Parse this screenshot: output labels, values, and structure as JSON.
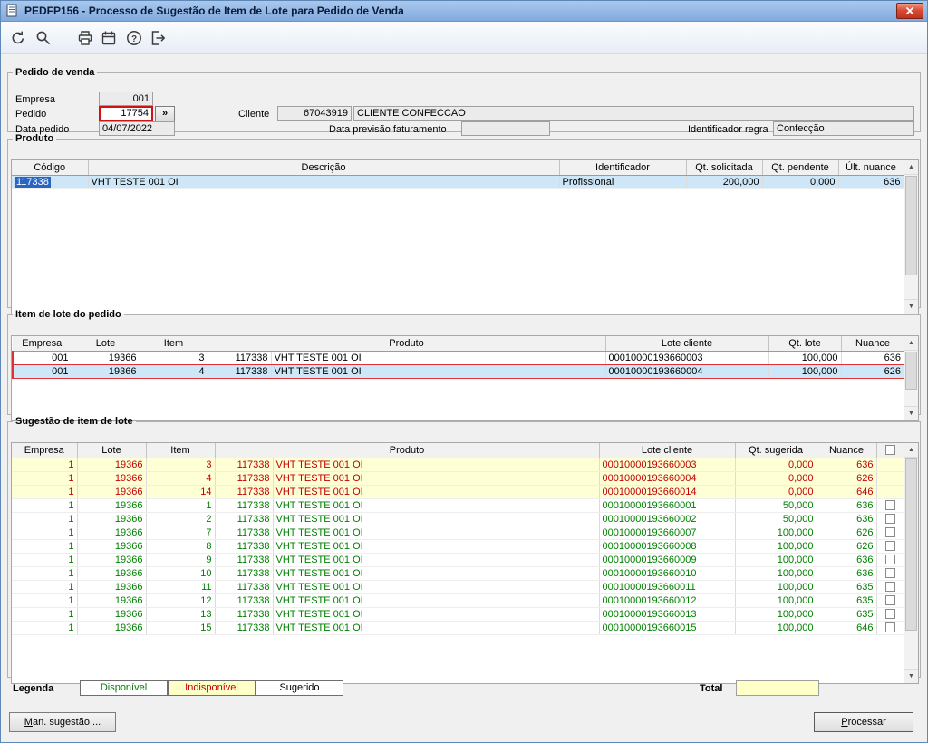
{
  "window": {
    "title": "PEDFP156 - Processo de Sugestão de Item de Lote para Pedido de Venda"
  },
  "toolbar": {
    "buttons": [
      "undo",
      "search",
      "print",
      "calendar",
      "help",
      "exit"
    ]
  },
  "icons": {
    "scroll_up": "▲",
    "scroll_down": "▼"
  },
  "form": {
    "group_title": "Pedido de venda",
    "empresa": {
      "label": "Empresa",
      "value": "001"
    },
    "pedido": {
      "label": "Pedido",
      "value": "17754",
      "lookup": "»"
    },
    "data_pedido": {
      "label": "Data pedido",
      "value": "04/07/2022"
    },
    "cliente": {
      "label": "Cliente",
      "code": "67043919",
      "name": "CLIENTE CONFECCAO"
    },
    "data_previsao": {
      "label": "Data previsão faturamento",
      "value": ""
    },
    "identificador_regra": {
      "label": "Identificador regra",
      "value": "Confecção"
    }
  },
  "produto": {
    "group_title": "Produto",
    "columns": [
      "Código",
      "Descrição",
      "Identificador",
      "Qt. solicitada",
      "Qt. pendente",
      "Últ. nuance"
    ],
    "rows": [
      {
        "status": "selected-produto",
        "codigo": "117338",
        "descricao": "VHT TESTE 001 OI",
        "identificador": "Profissional",
        "qt_solicitada": "200,000",
        "qt_pendente": "0,000",
        "ult_nuance": "636"
      }
    ]
  },
  "item_lote": {
    "group_title": "Item de lote do pedido",
    "columns": [
      "Empresa",
      "Lote",
      "Item",
      "Produto",
      "Lote cliente",
      "Qt. lote",
      "Nuance"
    ],
    "rows": [
      {
        "status": "outline",
        "empresa": "001",
        "lote": "19366",
        "item": "3",
        "produto_cod": "117338",
        "produto_desc": "VHT TESTE 001 OI",
        "lote_cliente": "00010000193660003",
        "qt_lote": "100,000",
        "nuance": "636"
      },
      {
        "status": "outline selected",
        "empresa": "001",
        "lote": "19366",
        "item": "4",
        "produto_cod": "117338",
        "produto_desc": "VHT TESTE 001 OI",
        "lote_cliente": "00010000193660004",
        "qt_lote": "100,000",
        "nuance": "626"
      }
    ]
  },
  "sugestao": {
    "group_title": "Sugestão de item de lote",
    "columns": [
      "Empresa",
      "Lote",
      "Item",
      "Produto",
      "Lote cliente",
      "Qt. sugerida",
      "Nuance"
    ],
    "rows": [
      {
        "status": "indisponivel",
        "checkbox": false,
        "empresa": "1",
        "lote": "19366",
        "item": "3",
        "produto_cod": "117338",
        "produto_desc": "VHT TESTE 001 OI",
        "lote_cliente": "00010000193660003",
        "qt_sugerida": "0,000",
        "nuance": "636"
      },
      {
        "status": "indisponivel",
        "checkbox": false,
        "empresa": "1",
        "lote": "19366",
        "item": "4",
        "produto_cod": "117338",
        "produto_desc": "VHT TESTE 001 OI",
        "lote_cliente": "00010000193660004",
        "qt_sugerida": "0,000",
        "nuance": "626"
      },
      {
        "status": "indisponivel",
        "checkbox": false,
        "empresa": "1",
        "lote": "19366",
        "item": "14",
        "produto_cod": "117338",
        "produto_desc": "VHT TESTE 001 OI",
        "lote_cliente": "00010000193660014",
        "qt_sugerida": "0,000",
        "nuance": "646"
      },
      {
        "status": "disponivel",
        "checkbox": true,
        "empresa": "1",
        "lote": "19366",
        "item": "1",
        "produto_cod": "117338",
        "produto_desc": "VHT TESTE 001 OI",
        "lote_cliente": "00010000193660001",
        "qt_sugerida": "50,000",
        "nuance": "636"
      },
      {
        "status": "disponivel",
        "checkbox": true,
        "empresa": "1",
        "lote": "19366",
        "item": "2",
        "produto_cod": "117338",
        "produto_desc": "VHT TESTE 001 OI",
        "lote_cliente": "00010000193660002",
        "qt_sugerida": "50,000",
        "nuance": "636"
      },
      {
        "status": "disponivel",
        "checkbox": true,
        "empresa": "1",
        "lote": "19366",
        "item": "7",
        "produto_cod": "117338",
        "produto_desc": "VHT TESTE 001 OI",
        "lote_cliente": "00010000193660007",
        "qt_sugerida": "100,000",
        "nuance": "626"
      },
      {
        "status": "disponivel",
        "checkbox": true,
        "empresa": "1",
        "lote": "19366",
        "item": "8",
        "produto_cod": "117338",
        "produto_desc": "VHT TESTE 001 OI",
        "lote_cliente": "00010000193660008",
        "qt_sugerida": "100,000",
        "nuance": "626"
      },
      {
        "status": "disponivel",
        "checkbox": true,
        "empresa": "1",
        "lote": "19366",
        "item": "9",
        "produto_cod": "117338",
        "produto_desc": "VHT TESTE 001 OI",
        "lote_cliente": "00010000193660009",
        "qt_sugerida": "100,000",
        "nuance": "636"
      },
      {
        "status": "disponivel",
        "checkbox": true,
        "empresa": "1",
        "lote": "19366",
        "item": "10",
        "produto_cod": "117338",
        "produto_desc": "VHT TESTE 001 OI",
        "lote_cliente": "00010000193660010",
        "qt_sugerida": "100,000",
        "nuance": "636"
      },
      {
        "status": "disponivel",
        "checkbox": true,
        "empresa": "1",
        "lote": "19366",
        "item": "11",
        "produto_cod": "117338",
        "produto_desc": "VHT TESTE 001 OI",
        "lote_cliente": "00010000193660011",
        "qt_sugerida": "100,000",
        "nuance": "635"
      },
      {
        "status": "disponivel",
        "checkbox": true,
        "empresa": "1",
        "lote": "19366",
        "item": "12",
        "produto_cod": "117338",
        "produto_desc": "VHT TESTE 001 OI",
        "lote_cliente": "00010000193660012",
        "qt_sugerida": "100,000",
        "nuance": "635"
      },
      {
        "status": "disponivel",
        "checkbox": true,
        "empresa": "1",
        "lote": "19366",
        "item": "13",
        "produto_cod": "117338",
        "produto_desc": "VHT TESTE 001 OI",
        "lote_cliente": "00010000193660013",
        "qt_sugerida": "100,000",
        "nuance": "635"
      },
      {
        "status": "disponivel",
        "checkbox": true,
        "empresa": "1",
        "lote": "19366",
        "item": "15",
        "produto_cod": "117338",
        "produto_desc": "VHT TESTE 001 OI",
        "lote_cliente": "00010000193660015",
        "qt_sugerida": "100,000",
        "nuance": "646"
      }
    ]
  },
  "legend": {
    "label": "Legenda",
    "items": [
      {
        "label": "Disponível"
      },
      {
        "label": "Indisponível"
      },
      {
        "label": "Sugerido"
      }
    ],
    "total_label": "Total",
    "total_value": ""
  },
  "buttons": {
    "man_sugestao": "Man. sugestão ...",
    "processar": "Processar"
  },
  "colors": {
    "available_text": "#008000",
    "unavailable_text": "#c00000",
    "unavailable_bg": "#ffffd6",
    "selection_bg": "#cde7f8",
    "alert_border": "#e03030",
    "titlebar": "#8fb3e3"
  }
}
